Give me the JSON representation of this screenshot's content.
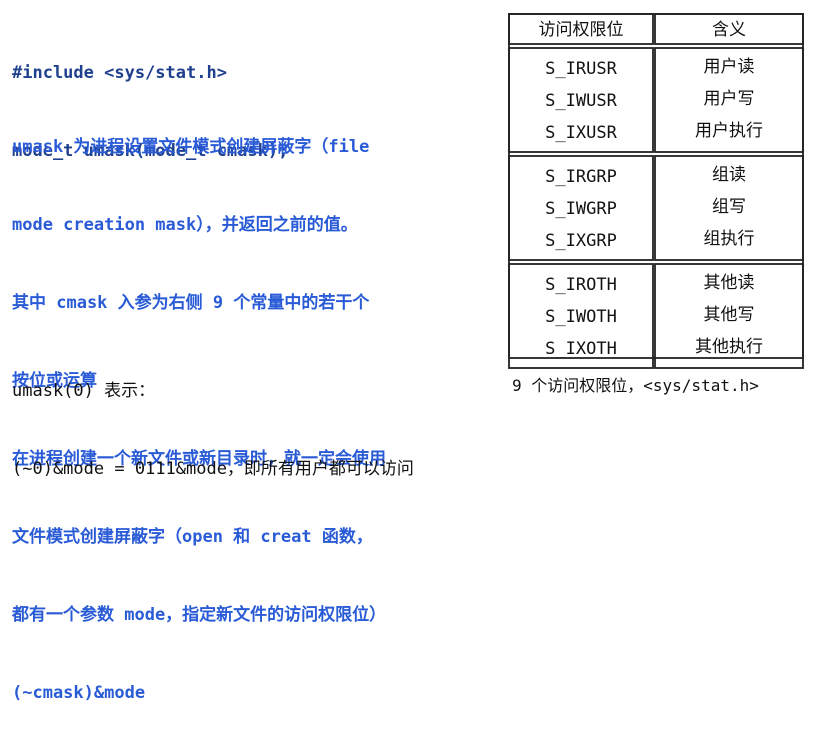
{
  "code": {
    "lines": [
      "#include <sys/stat.h>",
      "mode_t umask(mode_t cmask);"
    ]
  },
  "description": {
    "lines": [
      "umask 为进程设置文件模式创建屏蔽字（file",
      "mode creation mask），并返回之前的值。",
      "其中 cmask 入参为右侧 9 个常量中的若干个",
      "按位或运算",
      "在进程创建一个新文件或新目录时，就一定会使用",
      "文件模式创建屏蔽字（open 和 creat 函数，",
      "都有一个参数 mode，指定新文件的访问权限位）",
      "(~cmask)&mode"
    ]
  },
  "note": {
    "lines": [
      "umask(0) 表示：",
      "(~0)&mode = 0111&mode，即所有用户都可以访问"
    ]
  },
  "table": {
    "headers": [
      "访问权限位",
      "含义"
    ],
    "groups": [
      {
        "rows": [
          [
            "S_IRUSR",
            "用户读"
          ],
          [
            "S_IWUSR",
            "用户写"
          ],
          [
            "S_IXUSR",
            "用户执行"
          ]
        ]
      },
      {
        "rows": [
          [
            "S_IRGRP",
            "组读"
          ],
          [
            "S_IWGRP",
            "组写"
          ],
          [
            "S_IXGRP",
            "组执行"
          ]
        ]
      },
      {
        "rows": [
          [
            "S_IROTH",
            "其他读"
          ],
          [
            "S_IWOTH",
            "其他写"
          ],
          [
            "S_IXOTH",
            "其他执行"
          ]
        ]
      }
    ]
  },
  "caption": "9 个访问权限位，<sys/stat.h>"
}
